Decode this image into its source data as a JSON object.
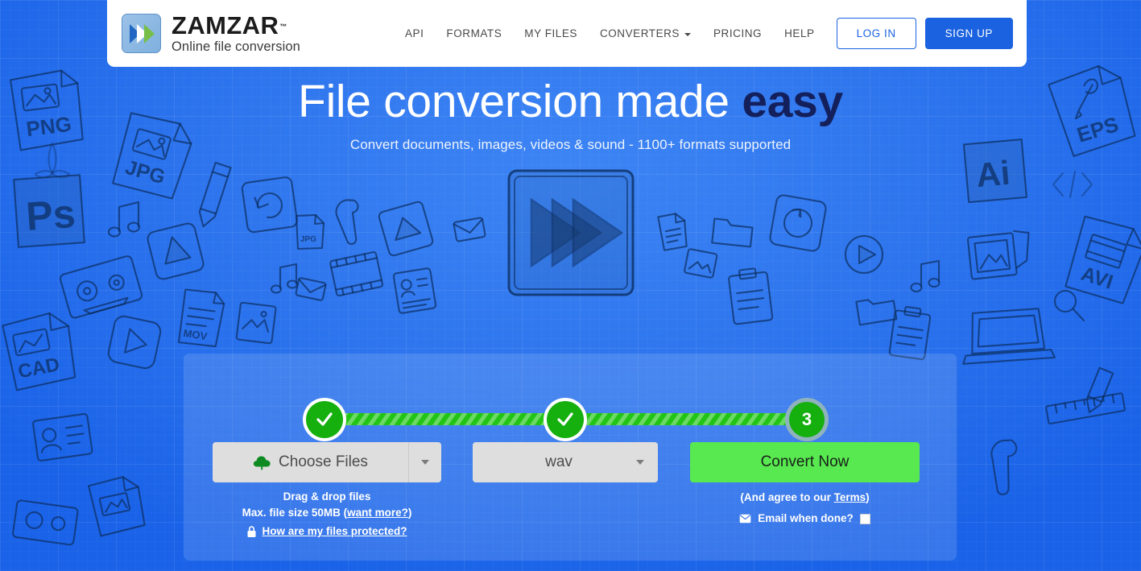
{
  "header": {
    "logo": {
      "word": "ZAMZAR",
      "tm": "™",
      "tagline": "Online file conversion",
      "icon": "zamzar-chevrons-icon"
    },
    "nav": [
      {
        "label": "API",
        "name": "nav-api"
      },
      {
        "label": "FORMATS",
        "name": "nav-formats"
      },
      {
        "label": "MY FILES",
        "name": "nav-my-files"
      },
      {
        "label": "CONVERTERS",
        "name": "nav-converters",
        "has_caret": true
      },
      {
        "label": "PRICING",
        "name": "nav-pricing"
      },
      {
        "label": "HELP",
        "name": "nav-help"
      }
    ],
    "login_label": "LOG IN",
    "signup_label": "SIGN UP"
  },
  "hero": {
    "title_plain": "File conversion made ",
    "title_accent": "easy",
    "subtitle": "Convert documents, images, videos & sound - 1100+ formats supported",
    "illustration": "sketch-fast-forward-icon"
  },
  "panel": {
    "steps": [
      {
        "state": "done",
        "glyph": "✓",
        "name": "step-1-complete"
      },
      {
        "state": "done",
        "glyph": "✓",
        "name": "step-2-complete"
      },
      {
        "state": "current",
        "glyph": "3",
        "name": "step-3-current"
      }
    ],
    "choose_files": {
      "label": "Choose Files",
      "icon": "cloud-upload-icon",
      "caret": "chevron-down-icon"
    },
    "format": {
      "value": "wav",
      "caret": "chevron-down-icon"
    },
    "convert_label": "Convert Now",
    "left_help": {
      "line1": "Drag & drop files",
      "line2_prefix": "Max. file size 50MB (",
      "line2_link": "want more?",
      "line2_suffix": ")",
      "protected_link": "How are my files protected?",
      "protected_icon": "lock-icon"
    },
    "right_help": {
      "terms_prefix": "(And agree to our ",
      "terms_link": "Terms",
      "terms_suffix": ")",
      "email_label": "Email when done?",
      "email_icon": "envelope-icon",
      "email_checked": false
    }
  },
  "background": {
    "doodles": [
      "PNG",
      "JPG",
      "PS",
      "CAD",
      "EPS",
      "Ai",
      "AVI"
    ]
  },
  "colors": {
    "page_blue": "#1a63e8",
    "brand_blue": "#1a62e0",
    "accent_navy": "#14205c",
    "step_green": "#15af0e",
    "bar_green": "#22c516",
    "convert_green": "#58e84f",
    "step_current_ring": "#8fb3bd",
    "control_grey": "#dedede"
  }
}
